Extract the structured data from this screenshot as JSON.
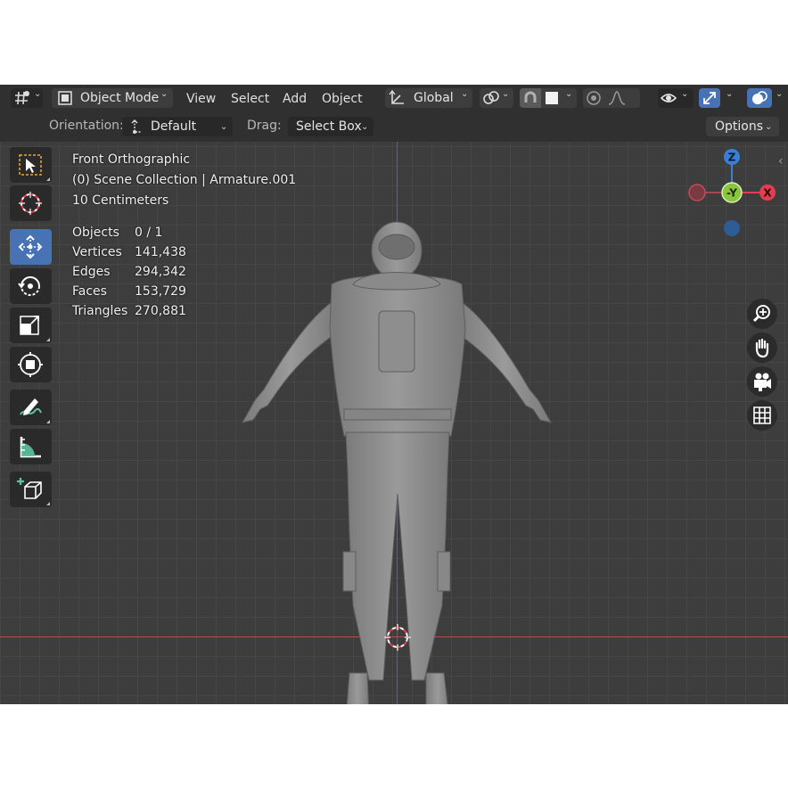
{
  "header": {
    "mode": "Object Mode",
    "menus": [
      "View",
      "Select",
      "Add",
      "Object"
    ],
    "transform_orientation": "Global"
  },
  "tool_settings": {
    "orientation_label": "Orientation:",
    "orientation_value": "Default",
    "drag_label": "Drag:",
    "drag_value": "Select Box",
    "options_label": "Options"
  },
  "overlay": {
    "view_name": "Front Orthographic",
    "collection": "(0) Scene Collection | Armature.001",
    "scale": "10 Centimeters",
    "stats": [
      {
        "label": "Objects",
        "value": "0 / 1"
      },
      {
        "label": "Vertices",
        "value": "141,438"
      },
      {
        "label": "Edges",
        "value": "294,342"
      },
      {
        "label": "Faces",
        "value": "153,729"
      },
      {
        "label": "Triangles",
        "value": "270,881"
      }
    ]
  },
  "gizmo": {
    "z": "Z",
    "y": "-Y",
    "x": "X"
  },
  "colors": {
    "accent": "#4772b3",
    "x_axis": "#e33d4f",
    "y_axis": "#8bc53f",
    "z_axis": "#3a7fd6"
  },
  "icons": {
    "editor_type": "grid-editor-icon",
    "tools": [
      "select-box-icon",
      "cursor-icon",
      "move-icon",
      "rotate-icon",
      "scale-icon",
      "transform-icon",
      "annotate-icon",
      "measure-icon",
      "add-cube-icon"
    ],
    "nav": [
      "zoom-icon",
      "pan-hand-icon",
      "camera-icon",
      "grid-view-icon"
    ]
  }
}
